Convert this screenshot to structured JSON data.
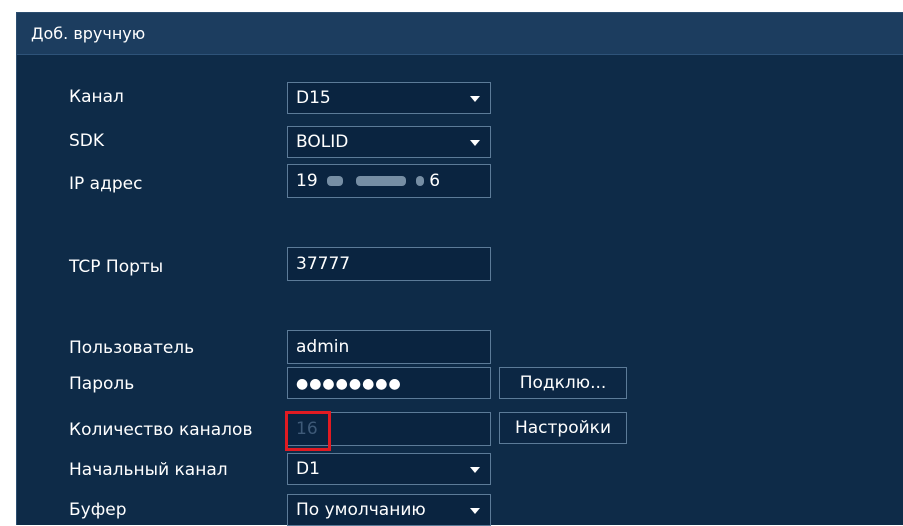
{
  "dialog": {
    "title": "Доб. вручную"
  },
  "form": {
    "channel": {
      "label": "Канал",
      "value": "D15"
    },
    "sdk": {
      "label": "SDK",
      "value": "BOLID"
    },
    "ip": {
      "label": "IP адрес",
      "value_start": "19",
      "value_end": "6"
    },
    "tcp_port": {
      "label": "TCP Порты",
      "value": "37777"
    },
    "user": {
      "label": "Пользователь",
      "value": "admin"
    },
    "password": {
      "label": "Пароль",
      "value": "●●●●●●●●"
    },
    "channel_count": {
      "label": "Количество каналов",
      "value": "16"
    },
    "start_channel": {
      "label": "Начальный канал",
      "value": "D1"
    },
    "buffer": {
      "label": "Буфер",
      "value": "По умолчанию"
    }
  },
  "buttons": {
    "connect": "Подклю...",
    "settings": "Настройки"
  },
  "colors": {
    "dialog_bg": "#0e2b48",
    "titlebar_bg": "#1c3d5f",
    "field_border": "#5c7b98",
    "highlight": "#e01b22"
  }
}
